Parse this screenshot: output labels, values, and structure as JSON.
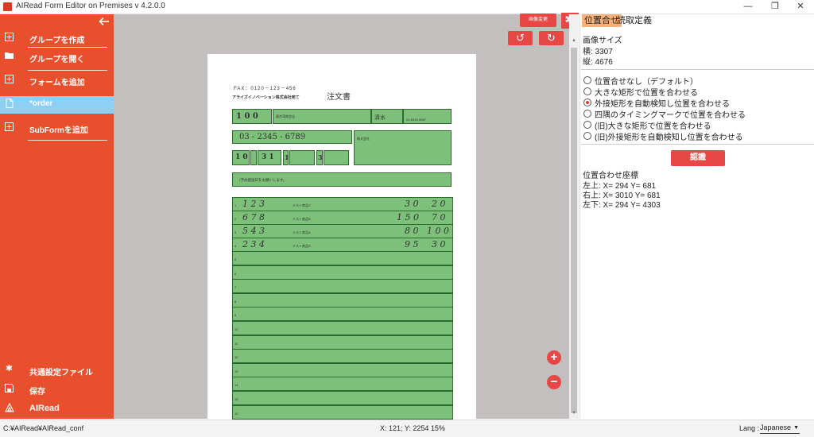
{
  "window": {
    "title": "AIRead Form Editor on Premises v 4.2.0.0",
    "minimize": "—",
    "maximize": "❐",
    "close": "✕"
  },
  "sidebar": {
    "back_icon": "arrow-left-icon",
    "items": [
      {
        "label": "グループを作成",
        "icon": "plus-box-icon"
      },
      {
        "label": "グループを開く",
        "icon": "folder-open-icon"
      },
      {
        "label": "フォームを追加",
        "icon": "plus-box-icon"
      },
      {
        "label": "*order",
        "icon": "document-icon"
      },
      {
        "label": "SubFormを追加",
        "icon": "plus-box-icon"
      }
    ],
    "bottom_items": [
      {
        "label": "共通設定ファイル",
        "icon": "gear-icon"
      },
      {
        "label": "保存",
        "icon": "save-icon"
      },
      {
        "label": "AIRead",
        "icon": "airead-logo-icon"
      }
    ]
  },
  "toolbar": {
    "image_change_label": "画像変更",
    "settings_icon": "gear-icon",
    "rotate_left_icon": "rotate-left-icon",
    "rotate_right_icon": "rotate-right-icon",
    "zoom_in_icon": "plus-icon",
    "zoom_out_icon": "minus-icon"
  },
  "right_panel": {
    "tabs": [
      {
        "label": "位置合せ",
        "active": true
      },
      {
        "label": "読取定義",
        "active": false
      }
    ],
    "image_size_label": "画像サイズ",
    "width_text": "横: 3307",
    "height_text": "縦: 4676",
    "align_options": [
      {
        "label": "位置合せなし（デフォルト）",
        "selected": false
      },
      {
        "label": "大きな矩形で位置を合わせる",
        "selected": false
      },
      {
        "label": "外接矩形を自動検知し位置を合わせる",
        "selected": true
      },
      {
        "label": "四隅のタイミングマークで位置を合わせる",
        "selected": false
      },
      {
        "label": "(旧)大きな矩形で位置を合わせる",
        "selected": false
      },
      {
        "label": "(旧)外接矩形を自動検知し位置を合わせる",
        "selected": false
      }
    ],
    "recognize_button": "認識",
    "coords_title": "位置合わせ座標",
    "coords": [
      "左上: X= 294   Y= 681",
      "右上: X= 3010   Y= 681",
      "左下: X= 294   Y= 4303"
    ]
  },
  "form": {
    "fax": "FAX：0120－123－456",
    "company": "アライズイノベーション株式会社宛て",
    "title": "注文書",
    "customer_code": "1 0 0",
    "customer_name": "東京湾商会店",
    "person": "清水",
    "tel": "03-5534-9687",
    "phone": "03 - 2345 - 6789",
    "address_company": "株式会社",
    "date": "1 0",
    "date2": "3 1",
    "count1": "1",
    "count2": "3",
    "notice": "（予め配送日をお願いします。",
    "rows": [
      {
        "num": "1",
        "code": "1 2 3",
        "name": "テスト商品C",
        "qty": "3 0",
        "unit": "2 0"
      },
      {
        "num": "2",
        "code": "6 7 8",
        "name": "テスト商品B",
        "qty": "1 5 0",
        "unit": "7 0"
      },
      {
        "num": "3",
        "code": "5 4 3",
        "name": "テスト商品A",
        "qty": "8 0",
        "unit": "1 0 0"
      },
      {
        "num": "4",
        "code": "2 3 4",
        "name": "テスト商品D",
        "qty": "9 5",
        "unit": "3 0"
      }
    ],
    "empty_row_numbers": [
      "5",
      "6",
      "7",
      "8",
      "9",
      "10",
      "11",
      "12",
      "13",
      "14",
      "15",
      "16",
      "17"
    ]
  },
  "status": {
    "path": "C:¥AIRead¥AIRead_conf",
    "cursor": "X: 121; Y: 2254   15%",
    "lang_label": "Lang :",
    "lang_value": "Japanese"
  },
  "colors": {
    "sidebar": "#e84f2c",
    "sidebar_selected": "#8ecff6",
    "accent_red": "#e84845",
    "form_green": "#7dc07a",
    "canvas_gray": "#c3bfbf"
  }
}
